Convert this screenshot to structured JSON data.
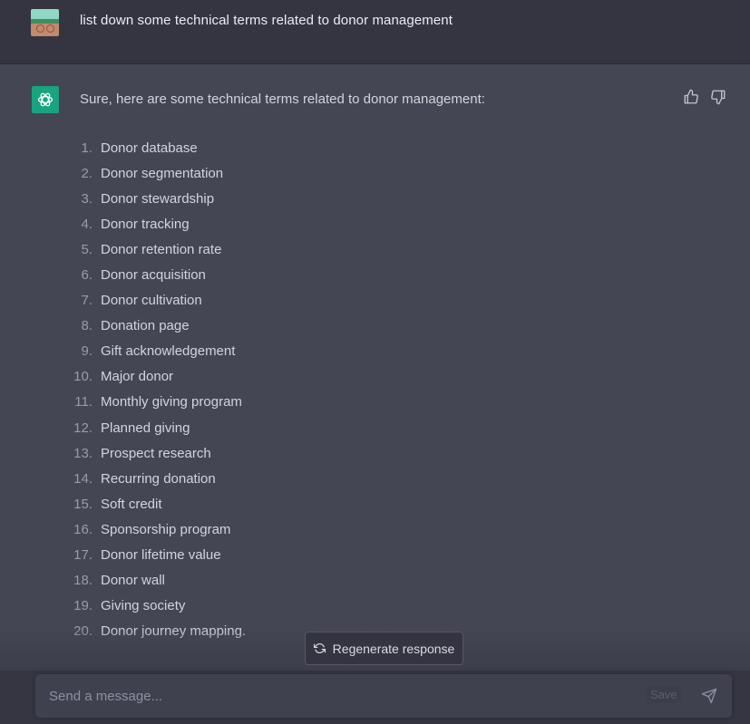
{
  "user_message": {
    "avatar": "user-avatar-image",
    "text": "list down some technical terms related to donor management"
  },
  "assistant_message": {
    "avatar": "openai-logo-icon",
    "intro": "Sure, here are some technical terms related to donor management:",
    "feedback": {
      "thumbs_up": "thumbs-up-icon",
      "thumbs_down": "thumbs-down-icon"
    },
    "terms": [
      {
        "num": "1.",
        "text": "Donor database"
      },
      {
        "num": "2.",
        "text": "Donor segmentation"
      },
      {
        "num": "3.",
        "text": "Donor stewardship"
      },
      {
        "num": "4.",
        "text": "Donor tracking"
      },
      {
        "num": "5.",
        "text": "Donor retention rate"
      },
      {
        "num": "6.",
        "text": "Donor acquisition"
      },
      {
        "num": "7.",
        "text": "Donor cultivation"
      },
      {
        "num": "8.",
        "text": "Donation page"
      },
      {
        "num": "9.",
        "text": "Gift acknowledgement"
      },
      {
        "num": "10.",
        "text": "Major donor"
      },
      {
        "num": "11.",
        "text": "Monthly giving program"
      },
      {
        "num": "12.",
        "text": "Planned giving"
      },
      {
        "num": "13.",
        "text": "Prospect research"
      },
      {
        "num": "14.",
        "text": "Recurring donation"
      },
      {
        "num": "15.",
        "text": "Soft credit"
      },
      {
        "num": "16.",
        "text": "Sponsorship program"
      },
      {
        "num": "17.",
        "text": "Donor lifetime value"
      },
      {
        "num": "18.",
        "text": "Donor wall"
      },
      {
        "num": "19.",
        "text": "Giving society"
      },
      {
        "num": "20.",
        "text": "Donor journey mapping."
      }
    ]
  },
  "regenerate": {
    "icon": "refresh-icon",
    "label": "Regenerate response"
  },
  "composer": {
    "placeholder": "Send a message...",
    "value": "",
    "save_label": "Save",
    "send_icon": "send-icon"
  },
  "colors": {
    "accent": "#19a37f",
    "user_bg": "#343541",
    "assistant_bg": "#444654",
    "input_bg": "#40414f"
  }
}
